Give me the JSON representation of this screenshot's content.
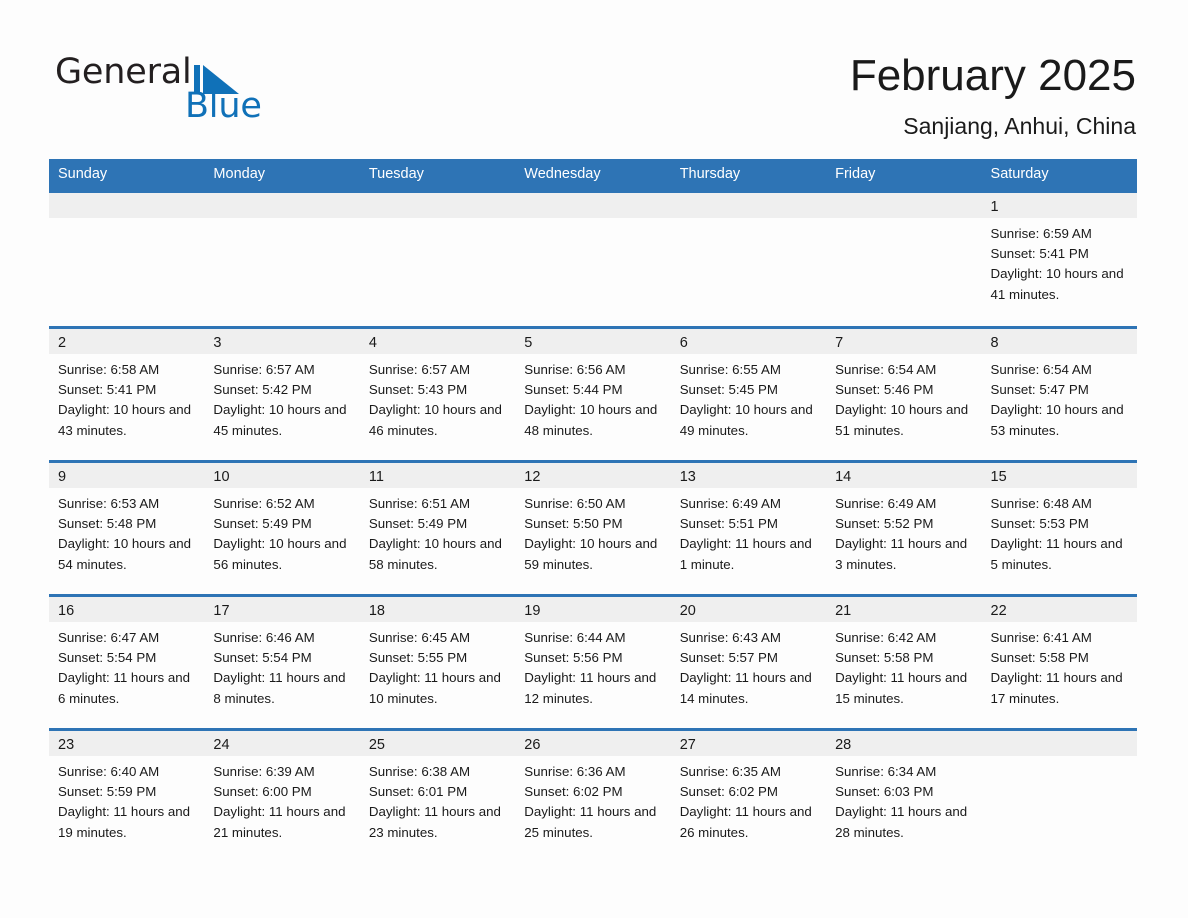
{
  "brand": {
    "name_part1": "General",
    "name_part2": "Blue",
    "logo_icon": "triangle-flag-icon",
    "accent_color": "#1071b8"
  },
  "header": {
    "month_title": "February 2025",
    "location": "Sanjiang, Anhui, China"
  },
  "theme": {
    "header_blue": "#2e74b5",
    "daynum_band": "#efefef",
    "page_background": "#fdfdfd",
    "text_color": "#1a1a1a"
  },
  "calendar": {
    "weekday_headers": [
      "Sunday",
      "Monday",
      "Tuesday",
      "Wednesday",
      "Thursday",
      "Friday",
      "Saturday"
    ],
    "weeks": [
      [
        {
          "day": "",
          "empty": true
        },
        {
          "day": "",
          "empty": true
        },
        {
          "day": "",
          "empty": true
        },
        {
          "day": "",
          "empty": true
        },
        {
          "day": "",
          "empty": true
        },
        {
          "day": "",
          "empty": true
        },
        {
          "day": "1",
          "sunrise": "Sunrise: 6:59 AM",
          "sunset": "Sunset: 5:41 PM",
          "daylight": "Daylight: 10 hours and 41 minutes."
        }
      ],
      [
        {
          "day": "2",
          "sunrise": "Sunrise: 6:58 AM",
          "sunset": "Sunset: 5:41 PM",
          "daylight": "Daylight: 10 hours and 43 minutes."
        },
        {
          "day": "3",
          "sunrise": "Sunrise: 6:57 AM",
          "sunset": "Sunset: 5:42 PM",
          "daylight": "Daylight: 10 hours and 45 minutes."
        },
        {
          "day": "4",
          "sunrise": "Sunrise: 6:57 AM",
          "sunset": "Sunset: 5:43 PM",
          "daylight": "Daylight: 10 hours and 46 minutes."
        },
        {
          "day": "5",
          "sunrise": "Sunrise: 6:56 AM",
          "sunset": "Sunset: 5:44 PM",
          "daylight": "Daylight: 10 hours and 48 minutes."
        },
        {
          "day": "6",
          "sunrise": "Sunrise: 6:55 AM",
          "sunset": "Sunset: 5:45 PM",
          "daylight": "Daylight: 10 hours and 49 minutes."
        },
        {
          "day": "7",
          "sunrise": "Sunrise: 6:54 AM",
          "sunset": "Sunset: 5:46 PM",
          "daylight": "Daylight: 10 hours and 51 minutes."
        },
        {
          "day": "8",
          "sunrise": "Sunrise: 6:54 AM",
          "sunset": "Sunset: 5:47 PM",
          "daylight": "Daylight: 10 hours and 53 minutes."
        }
      ],
      [
        {
          "day": "9",
          "sunrise": "Sunrise: 6:53 AM",
          "sunset": "Sunset: 5:48 PM",
          "daylight": "Daylight: 10 hours and 54 minutes."
        },
        {
          "day": "10",
          "sunrise": "Sunrise: 6:52 AM",
          "sunset": "Sunset: 5:49 PM",
          "daylight": "Daylight: 10 hours and 56 minutes."
        },
        {
          "day": "11",
          "sunrise": "Sunrise: 6:51 AM",
          "sunset": "Sunset: 5:49 PM",
          "daylight": "Daylight: 10 hours and 58 minutes."
        },
        {
          "day": "12",
          "sunrise": "Sunrise: 6:50 AM",
          "sunset": "Sunset: 5:50 PM",
          "daylight": "Daylight: 10 hours and 59 minutes."
        },
        {
          "day": "13",
          "sunrise": "Sunrise: 6:49 AM",
          "sunset": "Sunset: 5:51 PM",
          "daylight": "Daylight: 11 hours and 1 minute."
        },
        {
          "day": "14",
          "sunrise": "Sunrise: 6:49 AM",
          "sunset": "Sunset: 5:52 PM",
          "daylight": "Daylight: 11 hours and 3 minutes."
        },
        {
          "day": "15",
          "sunrise": "Sunrise: 6:48 AM",
          "sunset": "Sunset: 5:53 PM",
          "daylight": "Daylight: 11 hours and 5 minutes."
        }
      ],
      [
        {
          "day": "16",
          "sunrise": "Sunrise: 6:47 AM",
          "sunset": "Sunset: 5:54 PM",
          "daylight": "Daylight: 11 hours and 6 minutes."
        },
        {
          "day": "17",
          "sunrise": "Sunrise: 6:46 AM",
          "sunset": "Sunset: 5:54 PM",
          "daylight": "Daylight: 11 hours and 8 minutes."
        },
        {
          "day": "18",
          "sunrise": "Sunrise: 6:45 AM",
          "sunset": "Sunset: 5:55 PM",
          "daylight": "Daylight: 11 hours and 10 minutes."
        },
        {
          "day": "19",
          "sunrise": "Sunrise: 6:44 AM",
          "sunset": "Sunset: 5:56 PM",
          "daylight": "Daylight: 11 hours and 12 minutes."
        },
        {
          "day": "20",
          "sunrise": "Sunrise: 6:43 AM",
          "sunset": "Sunset: 5:57 PM",
          "daylight": "Daylight: 11 hours and 14 minutes."
        },
        {
          "day": "21",
          "sunrise": "Sunrise: 6:42 AM",
          "sunset": "Sunset: 5:58 PM",
          "daylight": "Daylight: 11 hours and 15 minutes."
        },
        {
          "day": "22",
          "sunrise": "Sunrise: 6:41 AM",
          "sunset": "Sunset: 5:58 PM",
          "daylight": "Daylight: 11 hours and 17 minutes."
        }
      ],
      [
        {
          "day": "23",
          "sunrise": "Sunrise: 6:40 AM",
          "sunset": "Sunset: 5:59 PM",
          "daylight": "Daylight: 11 hours and 19 minutes."
        },
        {
          "day": "24",
          "sunrise": "Sunrise: 6:39 AM",
          "sunset": "Sunset: 6:00 PM",
          "daylight": "Daylight: 11 hours and 21 minutes."
        },
        {
          "day": "25",
          "sunrise": "Sunrise: 6:38 AM",
          "sunset": "Sunset: 6:01 PM",
          "daylight": "Daylight: 11 hours and 23 minutes."
        },
        {
          "day": "26",
          "sunrise": "Sunrise: 6:36 AM",
          "sunset": "Sunset: 6:02 PM",
          "daylight": "Daylight: 11 hours and 25 minutes."
        },
        {
          "day": "27",
          "sunrise": "Sunrise: 6:35 AM",
          "sunset": "Sunset: 6:02 PM",
          "daylight": "Daylight: 11 hours and 26 minutes."
        },
        {
          "day": "28",
          "sunrise": "Sunrise: 6:34 AM",
          "sunset": "Sunset: 6:03 PM",
          "daylight": "Daylight: 11 hours and 28 minutes."
        },
        {
          "day": "",
          "empty": true
        }
      ]
    ]
  }
}
